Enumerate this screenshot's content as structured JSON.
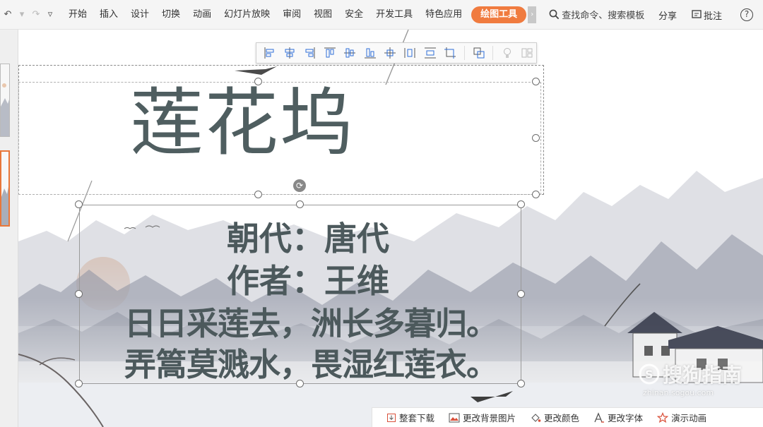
{
  "ribbon": {
    "menus": [
      "开始",
      "插入",
      "设计",
      "切换",
      "动画",
      "幻灯片放映",
      "审阅",
      "视图",
      "安全",
      "开发工具",
      "特色应用"
    ],
    "active_tool_tab": "绘图工具",
    "search_placeholder": "查找命令、搜索模板",
    "share": "分享",
    "comment": "批注",
    "help": "?"
  },
  "slide": {
    "title": "莲花坞",
    "lines": {
      "dynasty": "朝代：唐代",
      "author": "作者：王维",
      "verse1": "日日采莲去，洲长多暮归。",
      "verse2": "弄篙莫溅水，畏湿红莲衣。"
    }
  },
  "action_bar": {
    "download": "整套下载",
    "change_bg": "更改背景图片",
    "change_color": "更改颜色",
    "change_font": "更改字体",
    "demo_animation": "演示动画"
  },
  "watermark": {
    "text": "搜狗指南",
    "url": "zhinan.sogou.com"
  },
  "colors": {
    "accent": "#f07b3f",
    "title_text": "#4f5e60"
  }
}
